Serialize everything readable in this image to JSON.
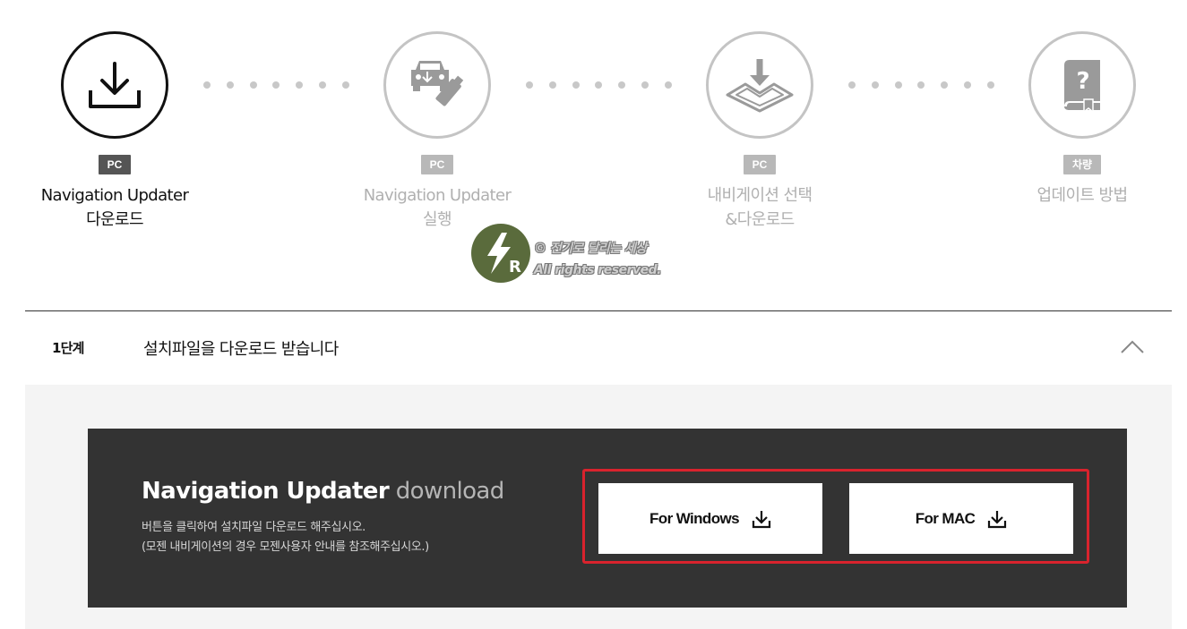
{
  "steps": [
    {
      "badge": "PC",
      "title_line1": "Navigation Updater",
      "title_line2": "다운로드",
      "icon": "download-icon",
      "active": true
    },
    {
      "badge": "PC",
      "title_line1": "Navigation Updater",
      "title_line2": "실행",
      "icon": "car-usb-icon",
      "active": false
    },
    {
      "badge": "PC",
      "title_line1": "내비게이션 선택",
      "title_line2": "&다운로드",
      "icon": "box-download-icon",
      "active": false
    },
    {
      "badge": "차량",
      "title_line1": "업데이트 방법",
      "title_line2": "",
      "icon": "manual-book-icon",
      "active": false
    }
  ],
  "watermark": {
    "line1": "© 전기로 달리는 세상",
    "line2": "All rights reserved."
  },
  "accordion": {
    "step_label": "1단계",
    "title": "설치파일을 다운로드 받습니다"
  },
  "download": {
    "heading_strong": "Navigation Updater",
    "heading_light": "download",
    "desc_line1": "버튼을 클릭하여 설치파일 다운로드 해주십시오.",
    "desc_line2": "(모젠 내비게이션의 경우 모젠사용자 안내를 참조해주십시오.)",
    "windows_label": "For Windows",
    "mac_label": "For MAC"
  },
  "colors": {
    "active": "#111111",
    "inactive": "#c4c4c4",
    "panel": "#333333",
    "highlight": "#d9232d",
    "watermark_green": "#5a6b3c"
  }
}
